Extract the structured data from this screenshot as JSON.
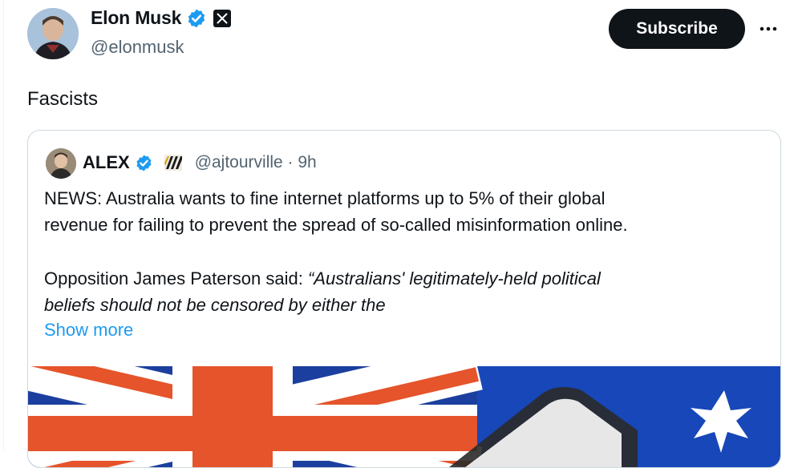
{
  "author": {
    "name": "Elon Musk",
    "handle": "@elonmusk",
    "verified_icon": "verified-badge-icon",
    "affiliate_icon": "x-logo-icon"
  },
  "actions": {
    "subscribe_label": "Subscribe",
    "more_icon": "more-options-icon"
  },
  "tweet": {
    "text": "Fascists"
  },
  "quote": {
    "name": "ALEX",
    "handle_time": "@ajtourville · 9h",
    "line1": "NEWS: Australia wants to fine internet platforms up to 5% of their global",
    "line2": "revenue for failing to prevent the spread of so-called misinformation online.",
    "line3_prefix": "Opposition James Paterson said: ",
    "line3_italic": "“Australians' legitimately-held political",
    "line4_italic": "beliefs should not be censored by either the",
    "show_more": "Show more",
    "media_icon": "australian-flag-image"
  },
  "colors": {
    "text": "#0f1419",
    "secondary": "#536471",
    "link": "#1d9bf0",
    "verified": "#1d9bf0",
    "border": "#cfd9de",
    "flag_blue": "#0e3ba0",
    "flag_red": "#e5542a"
  }
}
